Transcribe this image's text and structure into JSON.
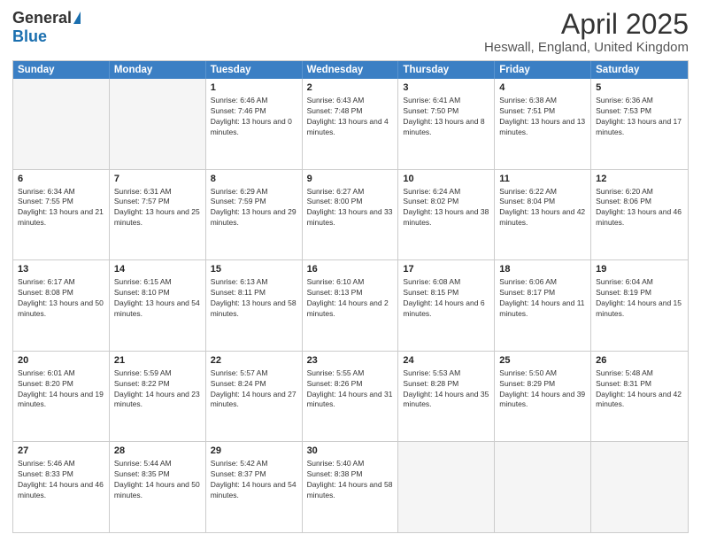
{
  "logo": {
    "general": "General",
    "blue": "Blue"
  },
  "header": {
    "title": "April 2025",
    "subtitle": "Heswall, England, United Kingdom"
  },
  "days": [
    "Sunday",
    "Monday",
    "Tuesday",
    "Wednesday",
    "Thursday",
    "Friday",
    "Saturday"
  ],
  "rows": [
    [
      {
        "day": "",
        "info": ""
      },
      {
        "day": "",
        "info": ""
      },
      {
        "day": "1",
        "info": "Sunrise: 6:46 AM\nSunset: 7:46 PM\nDaylight: 13 hours and 0 minutes."
      },
      {
        "day": "2",
        "info": "Sunrise: 6:43 AM\nSunset: 7:48 PM\nDaylight: 13 hours and 4 minutes."
      },
      {
        "day": "3",
        "info": "Sunrise: 6:41 AM\nSunset: 7:50 PM\nDaylight: 13 hours and 8 minutes."
      },
      {
        "day": "4",
        "info": "Sunrise: 6:38 AM\nSunset: 7:51 PM\nDaylight: 13 hours and 13 minutes."
      },
      {
        "day": "5",
        "info": "Sunrise: 6:36 AM\nSunset: 7:53 PM\nDaylight: 13 hours and 17 minutes."
      }
    ],
    [
      {
        "day": "6",
        "info": "Sunrise: 6:34 AM\nSunset: 7:55 PM\nDaylight: 13 hours and 21 minutes."
      },
      {
        "day": "7",
        "info": "Sunrise: 6:31 AM\nSunset: 7:57 PM\nDaylight: 13 hours and 25 minutes."
      },
      {
        "day": "8",
        "info": "Sunrise: 6:29 AM\nSunset: 7:59 PM\nDaylight: 13 hours and 29 minutes."
      },
      {
        "day": "9",
        "info": "Sunrise: 6:27 AM\nSunset: 8:00 PM\nDaylight: 13 hours and 33 minutes."
      },
      {
        "day": "10",
        "info": "Sunrise: 6:24 AM\nSunset: 8:02 PM\nDaylight: 13 hours and 38 minutes."
      },
      {
        "day": "11",
        "info": "Sunrise: 6:22 AM\nSunset: 8:04 PM\nDaylight: 13 hours and 42 minutes."
      },
      {
        "day": "12",
        "info": "Sunrise: 6:20 AM\nSunset: 8:06 PM\nDaylight: 13 hours and 46 minutes."
      }
    ],
    [
      {
        "day": "13",
        "info": "Sunrise: 6:17 AM\nSunset: 8:08 PM\nDaylight: 13 hours and 50 minutes."
      },
      {
        "day": "14",
        "info": "Sunrise: 6:15 AM\nSunset: 8:10 PM\nDaylight: 13 hours and 54 minutes."
      },
      {
        "day": "15",
        "info": "Sunrise: 6:13 AM\nSunset: 8:11 PM\nDaylight: 13 hours and 58 minutes."
      },
      {
        "day": "16",
        "info": "Sunrise: 6:10 AM\nSunset: 8:13 PM\nDaylight: 14 hours and 2 minutes."
      },
      {
        "day": "17",
        "info": "Sunrise: 6:08 AM\nSunset: 8:15 PM\nDaylight: 14 hours and 6 minutes."
      },
      {
        "day": "18",
        "info": "Sunrise: 6:06 AM\nSunset: 8:17 PM\nDaylight: 14 hours and 11 minutes."
      },
      {
        "day": "19",
        "info": "Sunrise: 6:04 AM\nSunset: 8:19 PM\nDaylight: 14 hours and 15 minutes."
      }
    ],
    [
      {
        "day": "20",
        "info": "Sunrise: 6:01 AM\nSunset: 8:20 PM\nDaylight: 14 hours and 19 minutes."
      },
      {
        "day": "21",
        "info": "Sunrise: 5:59 AM\nSunset: 8:22 PM\nDaylight: 14 hours and 23 minutes."
      },
      {
        "day": "22",
        "info": "Sunrise: 5:57 AM\nSunset: 8:24 PM\nDaylight: 14 hours and 27 minutes."
      },
      {
        "day": "23",
        "info": "Sunrise: 5:55 AM\nSunset: 8:26 PM\nDaylight: 14 hours and 31 minutes."
      },
      {
        "day": "24",
        "info": "Sunrise: 5:53 AM\nSunset: 8:28 PM\nDaylight: 14 hours and 35 minutes."
      },
      {
        "day": "25",
        "info": "Sunrise: 5:50 AM\nSunset: 8:29 PM\nDaylight: 14 hours and 39 minutes."
      },
      {
        "day": "26",
        "info": "Sunrise: 5:48 AM\nSunset: 8:31 PM\nDaylight: 14 hours and 42 minutes."
      }
    ],
    [
      {
        "day": "27",
        "info": "Sunrise: 5:46 AM\nSunset: 8:33 PM\nDaylight: 14 hours and 46 minutes."
      },
      {
        "day": "28",
        "info": "Sunrise: 5:44 AM\nSunset: 8:35 PM\nDaylight: 14 hours and 50 minutes."
      },
      {
        "day": "29",
        "info": "Sunrise: 5:42 AM\nSunset: 8:37 PM\nDaylight: 14 hours and 54 minutes."
      },
      {
        "day": "30",
        "info": "Sunrise: 5:40 AM\nSunset: 8:38 PM\nDaylight: 14 hours and 58 minutes."
      },
      {
        "day": "",
        "info": ""
      },
      {
        "day": "",
        "info": ""
      },
      {
        "day": "",
        "info": ""
      }
    ]
  ]
}
